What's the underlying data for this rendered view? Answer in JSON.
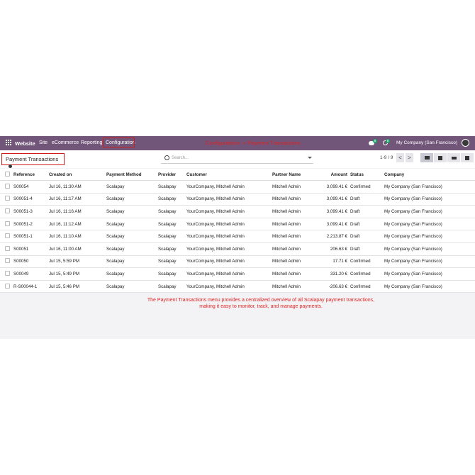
{
  "navbar": {
    "brand": "Website",
    "menus": [
      "Site",
      "eCommerce",
      "Reporting"
    ],
    "config_label": "Configuration",
    "annotation": "Configurations -> Payment Transactions",
    "chat_badge": "8",
    "activity_badge": "8",
    "company": "My Company (San Francisco)"
  },
  "control": {
    "title": "Payment Transactions",
    "search_placeholder": "Search...",
    "pager": "1-9 / 9",
    "prev": "<",
    "next": ">"
  },
  "table": {
    "headers": [
      "Reference",
      "Created on",
      "Payment Method",
      "Provider",
      "Customer",
      "Partner Name",
      "Amount",
      "Status",
      "Company"
    ],
    "rows": [
      [
        "S00054",
        "Jul 16, 11:30 AM",
        "Scalapay",
        "Scalapay",
        "YourCompany, Mitchell Admin",
        "Mitchell Admin",
        "3,099.41 €",
        "Confirmed",
        "My Company (San Francisco)"
      ],
      [
        "S00051-4",
        "Jul 16, 11:17 AM",
        "Scalapay",
        "Scalapay",
        "YourCompany, Mitchell Admin",
        "Mitchell Admin",
        "3,099.41 €",
        "Draft",
        "My Company (San Francisco)"
      ],
      [
        "S00051-3",
        "Jul 16, 11:16 AM",
        "Scalapay",
        "Scalapay",
        "YourCompany, Mitchell Admin",
        "Mitchell Admin",
        "3,099.41 €",
        "Draft",
        "My Company (San Francisco)"
      ],
      [
        "S00051-2",
        "Jul 16, 11:12 AM",
        "Scalapay",
        "Scalapay",
        "YourCompany, Mitchell Admin",
        "Mitchell Admin",
        "3,099.41 €",
        "Draft",
        "My Company (San Francisco)"
      ],
      [
        "S00051-1",
        "Jul 16, 11:10 AM",
        "Scalapay",
        "Scalapay",
        "YourCompany, Mitchell Admin",
        "Mitchell Admin",
        "2,213.87 €",
        "Draft",
        "My Company (San Francisco)"
      ],
      [
        "S00051",
        "Jul 16, 11:00 AM",
        "Scalapay",
        "Scalapay",
        "YourCompany, Mitchell Admin",
        "Mitchell Admin",
        "206.63 €",
        "Draft",
        "My Company (San Francisco)"
      ],
      [
        "S00050",
        "Jul 15, 5:59 PM",
        "Scalapay",
        "Scalapay",
        "YourCompany, Mitchell Admin",
        "Mitchell Admin",
        "17.71 €",
        "Confirmed",
        "My Company (San Francisco)"
      ],
      [
        "S00049",
        "Jul 15, 5:49 PM",
        "Scalapay",
        "Scalapay",
        "YourCompany, Mitchell Admin",
        "Mitchell Admin",
        "331.20 €",
        "Confirmed",
        "My Company (San Francisco)"
      ],
      [
        "R-S00044-1",
        "Jul 15, 5:46 PM",
        "Scalapay",
        "Scalapay",
        "YourCompany, Mitchell Admin",
        "Mitchell Admin",
        "-206.63 €",
        "Confirmed",
        "My Company (San Francisco)"
      ]
    ]
  },
  "annotation": {
    "line1": "The Payment Transactions menu provides a centralized overview of all Scalapay payment transactions,",
    "line2": "making it easy to monitor, track, and manage payments."
  },
  "colors": {
    "navbar": "#72567a",
    "annotation": "#e02020",
    "highlight": "#d11a1a"
  }
}
